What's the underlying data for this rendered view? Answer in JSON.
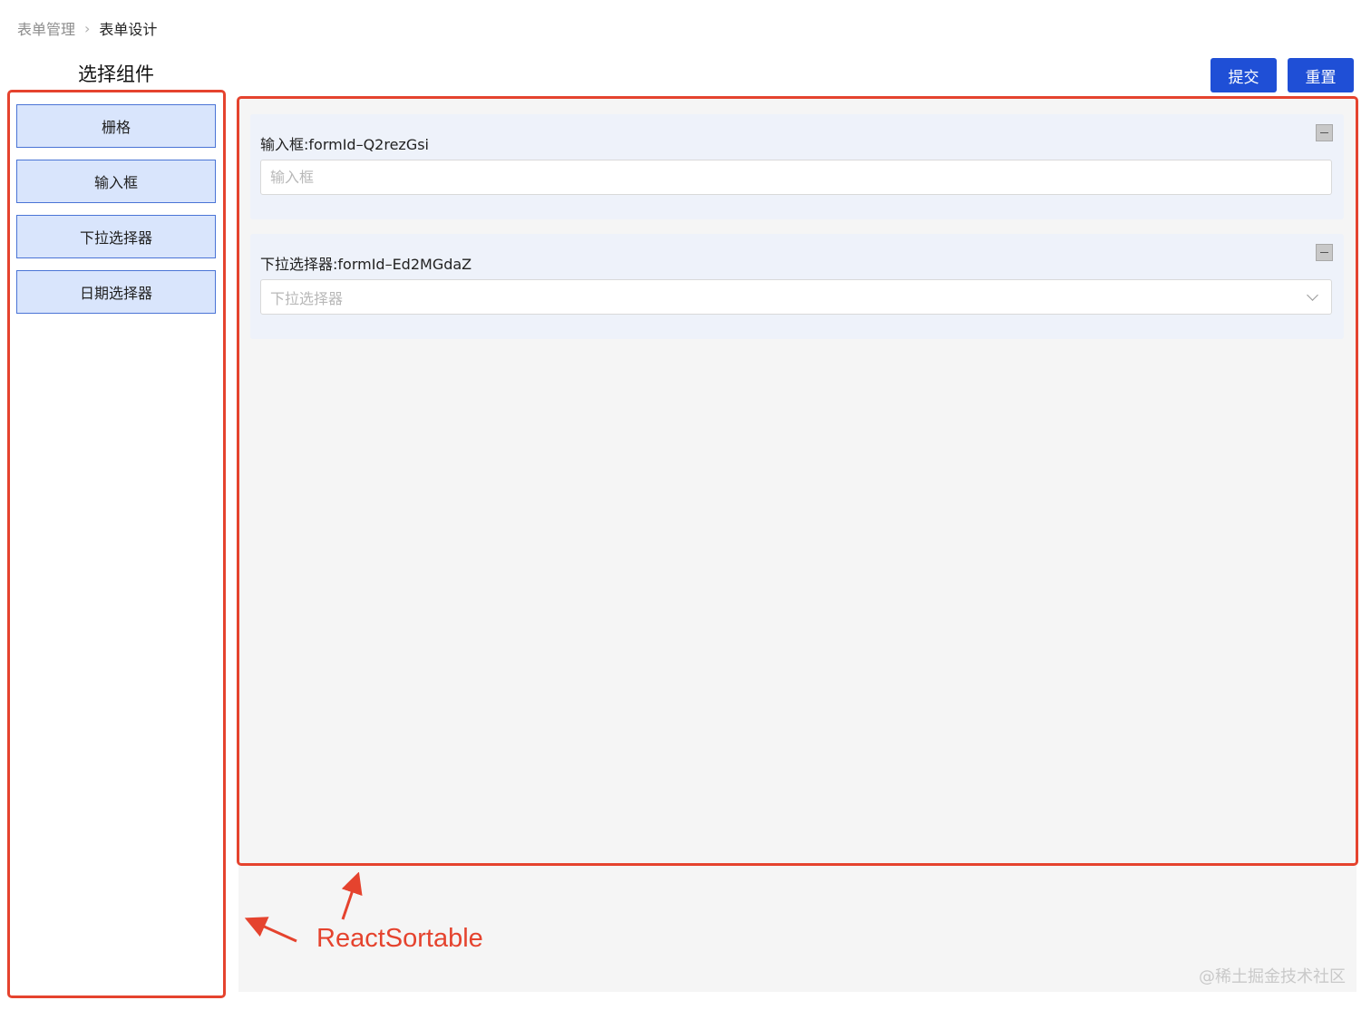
{
  "breadcrumb": {
    "parent": "表单管理",
    "separator": ">",
    "current": "表单设计"
  },
  "component_panel": {
    "title": "选择组件",
    "items": [
      "栅格",
      "输入框",
      "下拉选择器",
      "日期选择器"
    ]
  },
  "toolbar": {
    "submit_label": "提交",
    "reset_label": "重置"
  },
  "canvas": {
    "fields": [
      {
        "label": "输入框:formId–Q2rezGsi",
        "type": "input",
        "placeholder": "输入框"
      },
      {
        "label": "下拉选择器:formId–Ed2MGdaZ",
        "type": "select",
        "placeholder": "下拉选择器"
      }
    ]
  },
  "annotation": {
    "text": "ReactSortable",
    "color": "#e5432e"
  },
  "watermark": "@稀土掘金技术社区",
  "colors": {
    "primary": "#1f4fd6",
    "component_item_bg": "#d9e5fc",
    "component_item_border": "#4a74d6",
    "canvas_bg": "#f5f5f5",
    "field_card_bg": "#eef2fa"
  }
}
